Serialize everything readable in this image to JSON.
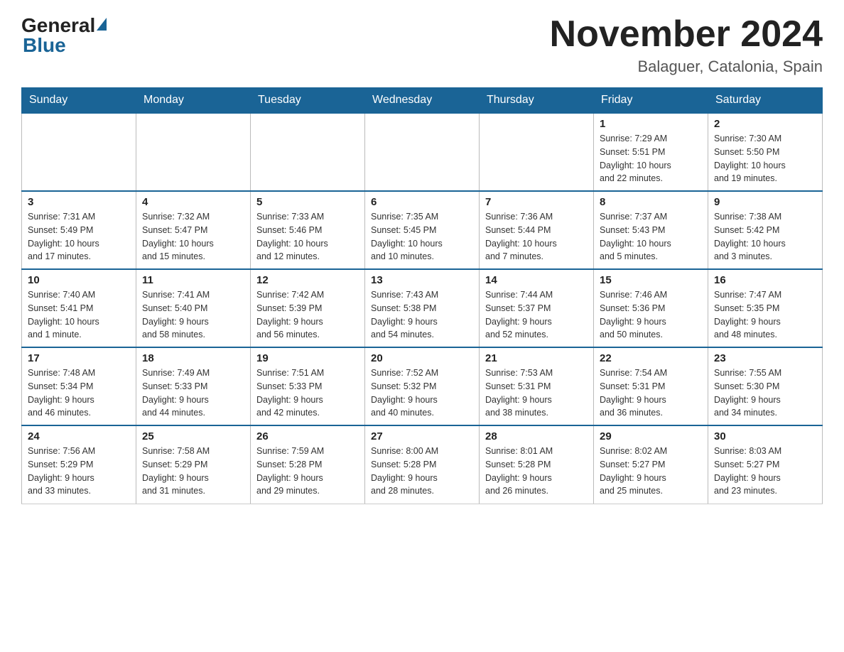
{
  "header": {
    "logo_general": "General",
    "logo_blue": "Blue",
    "month_title": "November 2024",
    "location": "Balaguer, Catalonia, Spain"
  },
  "days_of_week": [
    "Sunday",
    "Monday",
    "Tuesday",
    "Wednesday",
    "Thursday",
    "Friday",
    "Saturday"
  ],
  "weeks": [
    [
      {
        "day": "",
        "info": ""
      },
      {
        "day": "",
        "info": ""
      },
      {
        "day": "",
        "info": ""
      },
      {
        "day": "",
        "info": ""
      },
      {
        "day": "",
        "info": ""
      },
      {
        "day": "1",
        "info": "Sunrise: 7:29 AM\nSunset: 5:51 PM\nDaylight: 10 hours\nand 22 minutes."
      },
      {
        "day": "2",
        "info": "Sunrise: 7:30 AM\nSunset: 5:50 PM\nDaylight: 10 hours\nand 19 minutes."
      }
    ],
    [
      {
        "day": "3",
        "info": "Sunrise: 7:31 AM\nSunset: 5:49 PM\nDaylight: 10 hours\nand 17 minutes."
      },
      {
        "day": "4",
        "info": "Sunrise: 7:32 AM\nSunset: 5:47 PM\nDaylight: 10 hours\nand 15 minutes."
      },
      {
        "day": "5",
        "info": "Sunrise: 7:33 AM\nSunset: 5:46 PM\nDaylight: 10 hours\nand 12 minutes."
      },
      {
        "day": "6",
        "info": "Sunrise: 7:35 AM\nSunset: 5:45 PM\nDaylight: 10 hours\nand 10 minutes."
      },
      {
        "day": "7",
        "info": "Sunrise: 7:36 AM\nSunset: 5:44 PM\nDaylight: 10 hours\nand 7 minutes."
      },
      {
        "day": "8",
        "info": "Sunrise: 7:37 AM\nSunset: 5:43 PM\nDaylight: 10 hours\nand 5 minutes."
      },
      {
        "day": "9",
        "info": "Sunrise: 7:38 AM\nSunset: 5:42 PM\nDaylight: 10 hours\nand 3 minutes."
      }
    ],
    [
      {
        "day": "10",
        "info": "Sunrise: 7:40 AM\nSunset: 5:41 PM\nDaylight: 10 hours\nand 1 minute."
      },
      {
        "day": "11",
        "info": "Sunrise: 7:41 AM\nSunset: 5:40 PM\nDaylight: 9 hours\nand 58 minutes."
      },
      {
        "day": "12",
        "info": "Sunrise: 7:42 AM\nSunset: 5:39 PM\nDaylight: 9 hours\nand 56 minutes."
      },
      {
        "day": "13",
        "info": "Sunrise: 7:43 AM\nSunset: 5:38 PM\nDaylight: 9 hours\nand 54 minutes."
      },
      {
        "day": "14",
        "info": "Sunrise: 7:44 AM\nSunset: 5:37 PM\nDaylight: 9 hours\nand 52 minutes."
      },
      {
        "day": "15",
        "info": "Sunrise: 7:46 AM\nSunset: 5:36 PM\nDaylight: 9 hours\nand 50 minutes."
      },
      {
        "day": "16",
        "info": "Sunrise: 7:47 AM\nSunset: 5:35 PM\nDaylight: 9 hours\nand 48 minutes."
      }
    ],
    [
      {
        "day": "17",
        "info": "Sunrise: 7:48 AM\nSunset: 5:34 PM\nDaylight: 9 hours\nand 46 minutes."
      },
      {
        "day": "18",
        "info": "Sunrise: 7:49 AM\nSunset: 5:33 PM\nDaylight: 9 hours\nand 44 minutes."
      },
      {
        "day": "19",
        "info": "Sunrise: 7:51 AM\nSunset: 5:33 PM\nDaylight: 9 hours\nand 42 minutes."
      },
      {
        "day": "20",
        "info": "Sunrise: 7:52 AM\nSunset: 5:32 PM\nDaylight: 9 hours\nand 40 minutes."
      },
      {
        "day": "21",
        "info": "Sunrise: 7:53 AM\nSunset: 5:31 PM\nDaylight: 9 hours\nand 38 minutes."
      },
      {
        "day": "22",
        "info": "Sunrise: 7:54 AM\nSunset: 5:31 PM\nDaylight: 9 hours\nand 36 minutes."
      },
      {
        "day": "23",
        "info": "Sunrise: 7:55 AM\nSunset: 5:30 PM\nDaylight: 9 hours\nand 34 minutes."
      }
    ],
    [
      {
        "day": "24",
        "info": "Sunrise: 7:56 AM\nSunset: 5:29 PM\nDaylight: 9 hours\nand 33 minutes."
      },
      {
        "day": "25",
        "info": "Sunrise: 7:58 AM\nSunset: 5:29 PM\nDaylight: 9 hours\nand 31 minutes."
      },
      {
        "day": "26",
        "info": "Sunrise: 7:59 AM\nSunset: 5:28 PM\nDaylight: 9 hours\nand 29 minutes."
      },
      {
        "day": "27",
        "info": "Sunrise: 8:00 AM\nSunset: 5:28 PM\nDaylight: 9 hours\nand 28 minutes."
      },
      {
        "day": "28",
        "info": "Sunrise: 8:01 AM\nSunset: 5:28 PM\nDaylight: 9 hours\nand 26 minutes."
      },
      {
        "day": "29",
        "info": "Sunrise: 8:02 AM\nSunset: 5:27 PM\nDaylight: 9 hours\nand 25 minutes."
      },
      {
        "day": "30",
        "info": "Sunrise: 8:03 AM\nSunset: 5:27 PM\nDaylight: 9 hours\nand 23 minutes."
      }
    ]
  ]
}
